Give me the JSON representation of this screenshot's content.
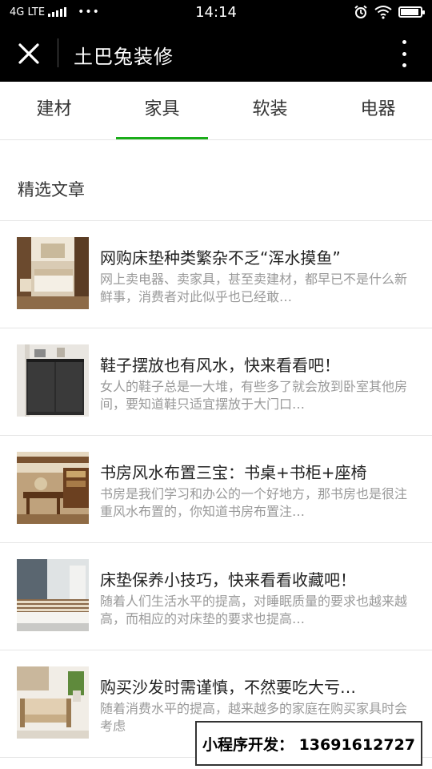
{
  "status_bar": {
    "network": "4G LTE",
    "dots": "•••",
    "time": "14:14",
    "icons": [
      "alarm-icon",
      "wifi-icon",
      "battery-icon"
    ],
    "battery_level": 0.9
  },
  "header": {
    "title": "土巴兔装修",
    "close_icon": "close-icon",
    "more_icon": "more-vertical-icon"
  },
  "tabs": [
    {
      "label": "建材",
      "active": false
    },
    {
      "label": "家具",
      "active": true
    },
    {
      "label": "软装",
      "active": false
    },
    {
      "label": "电器",
      "active": false
    }
  ],
  "section": {
    "title": "精选文章"
  },
  "articles": [
    {
      "title": "网购床垫种类繁杂不乏“浑水摸鱼”",
      "summary": "网上卖电器、卖家具，甚至卖建材，都早已不是什么新鲜事，消费者对此似乎也已经敢…",
      "thumb": "bedroom-photo"
    },
    {
      "title": "鞋子摆放也有风水，快来看看吧！",
      "summary": "女人的鞋子总是一大堆，有些多了就会放到卧室其他房间，要知道鞋只适宜摆放于大门口…",
      "thumb": "shoe-cabinet-photo"
    },
    {
      "title": "书房风水布置三宝：书桌+书柜+座椅",
      "summary": "书房是我们学习和办公的一个好地方，那书房也是很注重风水布置的，你知道书房布置注…",
      "thumb": "study-room-photo"
    },
    {
      "title": "床垫保养小技巧，快来看看收藏吧！",
      "summary": "随着人们生活水平的提高，对睡眠质量的要求也越来越高，而相应的对床垫的要求也提高…",
      "thumb": "mattress-photo"
    },
    {
      "title": "购买沙发时需谨慎，不然要吃大亏…",
      "summary": "随着消费水平的提高，越来越多的家庭在购买家具时会考虑",
      "thumb": "sofa-photo"
    }
  ],
  "watermark": "小程序开发： 13691612727"
}
